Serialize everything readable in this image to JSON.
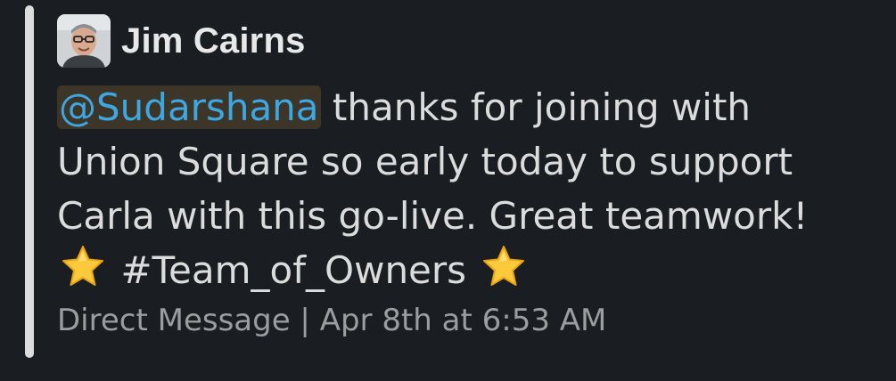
{
  "message": {
    "author": "Jim Cairns",
    "mention": "@Sudarshana",
    "text_part1": " thanks for joining with Union Square so early today to support Carla with this go-live.  Great teamwork! ",
    "hashtag": " #Team_of_Owners ",
    "emoji_1": "star-emoji",
    "emoji_2": "star-emoji",
    "channel": "Direct Message",
    "separator": " | ",
    "timestamp": "Apr 8th at 6:53 AM"
  },
  "colors": {
    "background": "#1a1d21",
    "mention_text": "#3da7e3",
    "mention_bg": "#3d3528",
    "body_text": "#dcdcdc",
    "meta_text": "#9b9d9f",
    "star_fill": "#fcc93a"
  }
}
